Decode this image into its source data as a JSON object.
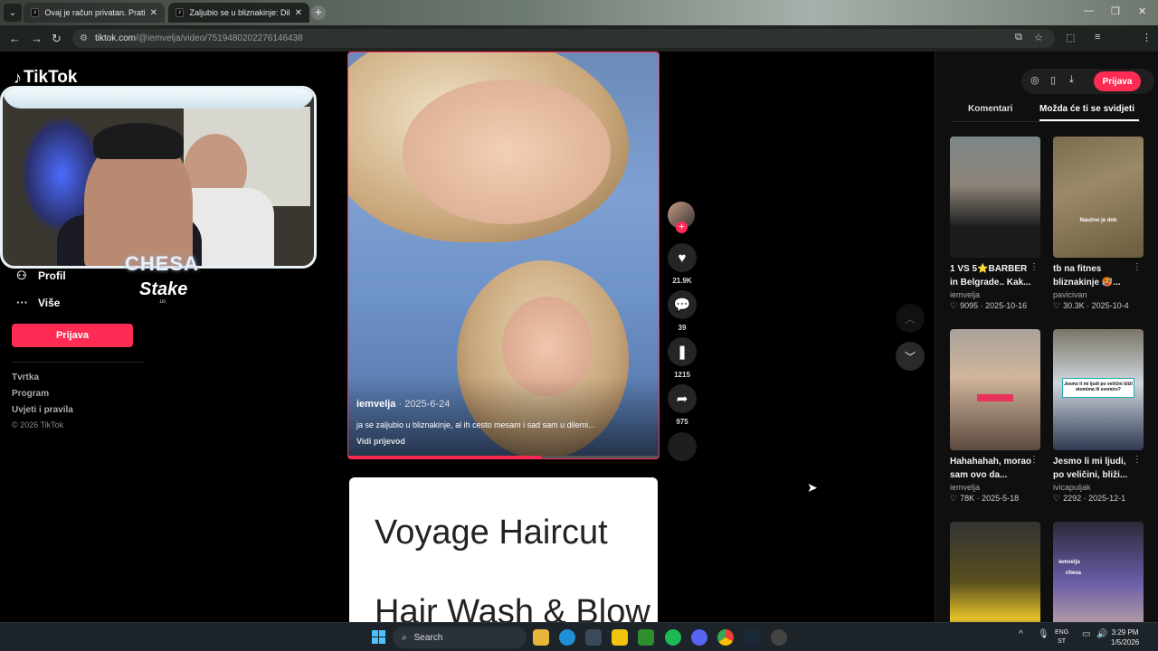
{
  "browser": {
    "tabs": [
      {
        "title": "Ovaj je račun privatan. Prati ov...",
        "favicon": "tiktok-icon"
      },
      {
        "title": "Zaljubio se u bliznakinje: Dilem...",
        "favicon": "tiktok-icon"
      }
    ],
    "url_host": "tiktok.com",
    "url_path": "/@iemvelja/video/7519480202276146438"
  },
  "sidebar": {
    "logo": "TikTok",
    "items": [
      {
        "label": "Profil",
        "icon": "user-icon"
      },
      {
        "label": "Više",
        "icon": "more-icon"
      }
    ],
    "login_label": "Prijava",
    "footer_links": [
      "Tvrtka",
      "Program",
      "Uvjeti i pravila"
    ],
    "copyright": "© 2026 TikTok"
  },
  "overlay": {
    "streamer_name": "CHESA",
    "sponsor": "Stake",
    "sponsor_suffix": ".us"
  },
  "video": {
    "author": "iemvelja",
    "date": " · 2025-6-24",
    "caption": "ja se zaljubio u bliznakinje, al ih cesto mesam i sad sam u dilemi...",
    "translate": "Vidi prijevod",
    "progress": 0.62,
    "likes": "21.9K",
    "comments": "39",
    "saves": "1215",
    "shares": "975"
  },
  "next_video": {
    "line1": "Voyage Haircut",
    "line2": "Hair Wash & Blow"
  },
  "right_panel": {
    "login_label": "Prijava",
    "tabs": [
      "Komentari",
      "Možda će ti se svidjeti"
    ],
    "active_tab": 1,
    "cards": [
      {
        "title": "1 VS 5⭐BARBER in Belgrade.. Kak...",
        "author": "iemvelja",
        "likes": "9095",
        "date": "2025-10-16"
      },
      {
        "title": "tb na fitnes bliznakinje 🥵...",
        "author": "pavicivan",
        "likes": "30.3K",
        "date": "2025-10-4"
      },
      {
        "title": "Hahahahah, morao sam ovo da...",
        "author": "iemvelja",
        "likes": "78K",
        "date": "2025-5-18"
      },
      {
        "title": "Jesmo li mi ljudi, po veličini, bliži...",
        "author": "ivicapuljak",
        "likes": "2292",
        "date": "2025-12-1"
      }
    ],
    "thumb_texts": {
      "t2": "Naučno je dok",
      "t4": "Jesmo li mi ljudi po veličini bliži atomima ili svemiru?",
      "t6a": "iemvelja",
      "t6b": "chesa"
    }
  },
  "taskbar": {
    "search_label": "Search",
    "lang": "ENG",
    "lang_sub": "ST",
    "time": "3:29 PM",
    "date": "1/5/2026"
  }
}
